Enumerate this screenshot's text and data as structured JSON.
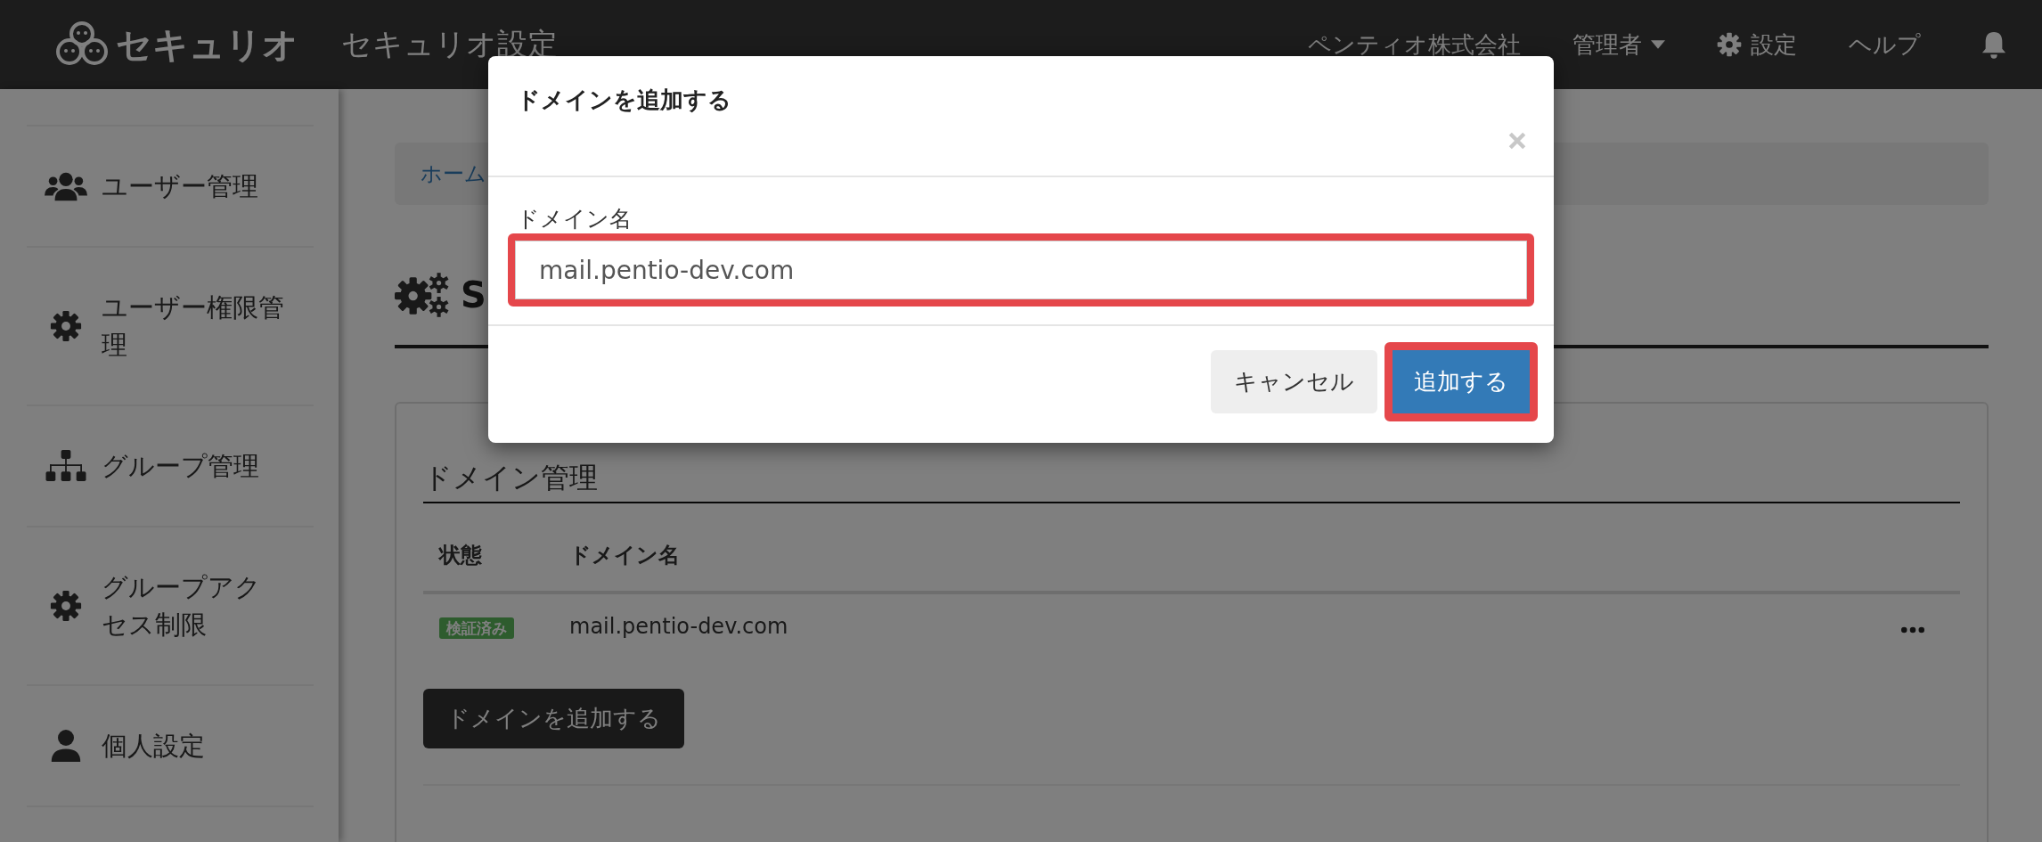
{
  "header": {
    "logo": "セキュリオ",
    "app_title": "セキュリオ設定",
    "company": "ペンティオ株式会社",
    "user_menu": "管理者",
    "settings": "設定",
    "help": "ヘルプ"
  },
  "sidebar": {
    "items": [
      {
        "label": "ユーザー管理",
        "kind": "users"
      },
      {
        "label": "ユーザー権限管理",
        "kind": "gear"
      },
      {
        "label": "グループ管理",
        "kind": "sitemap"
      },
      {
        "label": "グループアクセス制限",
        "kind": "gear"
      },
      {
        "label": "個人設定",
        "kind": "user"
      }
    ]
  },
  "breadcrumb": [
    "ホーム"
  ],
  "page_title": "S",
  "domain_card": {
    "title": "ドメイン管理",
    "columns": [
      "状態",
      "ドメイン名"
    ],
    "rows": [
      {
        "status": "検証済み",
        "domain": "mail.pentio-dev.com"
      }
    ],
    "add_button": "ドメインを追加する"
  },
  "modal": {
    "title": "ドメインを追加する",
    "field_label": "ドメイン名",
    "field_value": "mail.pentio-dev.com",
    "field_highlighted": true,
    "cancel": "キャンセル",
    "submit": "追加する",
    "submit_highlighted": true
  }
}
